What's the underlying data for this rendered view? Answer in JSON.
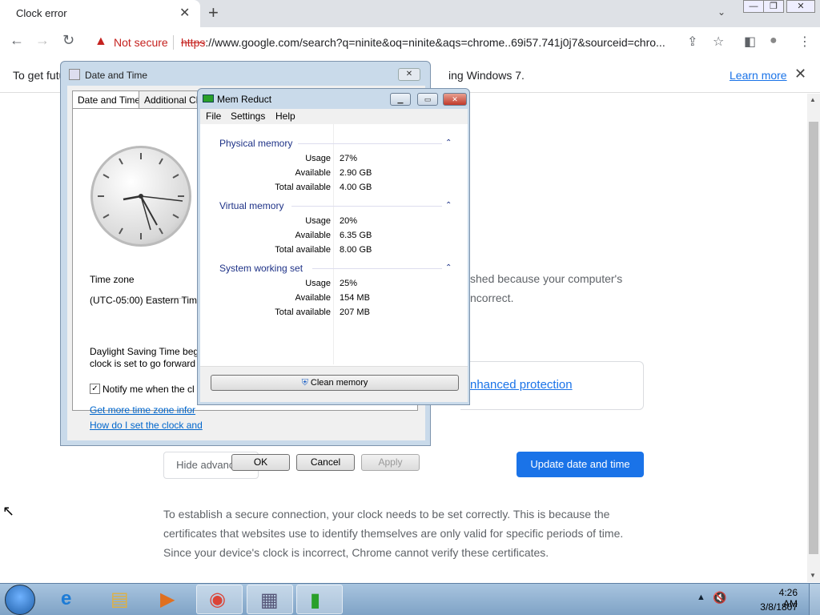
{
  "browser": {
    "tab_title": "Clock error",
    "tab_close": "✕",
    "new_tab": "+",
    "tab_search": "⌄",
    "security_label": "Not secure",
    "url_scheme": "https",
    "url_rest": "://www.google.com/search?q=ninite&oq=ninite&aqs=chrome..69i57.741j0j7&sourceid=chro...",
    "nav_back": "←",
    "nav_forward": "→",
    "nav_reload": "↻",
    "share_icon": "⇪",
    "star_icon": "☆",
    "sidepanel_icon": "◧",
    "profile_icon": "●",
    "menu_icon": "⋮"
  },
  "infobar": {
    "text_left": "To get futu",
    "text_right": "ing Windows 7.",
    "learn_more": "Learn more",
    "close": "✕"
  },
  "page": {
    "error_line1": "shed because your computer's",
    "error_line2": "ncorrect.",
    "enhanced_link": "nhanced protection",
    "hide_advanced": "Hide advanced",
    "update_button": "Update date and time",
    "explanation": "To establish a secure connection, your clock needs to be set correctly. This is because the certificates that websites use to identify themselves are only valid for specific periods of time. Since your device's clock is incorrect, Chrome cannot verify these certificates."
  },
  "date_time_dialog": {
    "title": "Date and Time",
    "close": "✕",
    "tabs": [
      "Date and Time",
      "Additional Cloc"
    ],
    "time_zone_label": "Time zone",
    "time_zone_value": "(UTC-05:00) Eastern Time",
    "dst_line1": "Daylight Saving Time beg",
    "dst_line2": "clock is set to go forward",
    "notify_label": "Notify me when the cl",
    "notify_checked": "✓",
    "link1": "Get more time zone infor",
    "link2": "How do I set the clock and",
    "ok": "OK",
    "cancel": "Cancel",
    "apply": "Apply"
  },
  "mem_reduct": {
    "title": "Mem Reduct",
    "minimize": "▁",
    "restore": "▭",
    "close": "✕",
    "menu": [
      "File",
      "Settings",
      "Help"
    ],
    "groups": [
      {
        "name": "Physical memory",
        "rows": [
          {
            "label": "Usage",
            "value": "27%"
          },
          {
            "label": "Available",
            "value": "2.90 GB"
          },
          {
            "label": "Total available",
            "value": "4.00 GB"
          }
        ]
      },
      {
        "name": "Virtual memory",
        "rows": [
          {
            "label": "Usage",
            "value": "20%"
          },
          {
            "label": "Available",
            "value": "6.35 GB"
          },
          {
            "label": "Total available",
            "value": "8.00 GB"
          }
        ]
      },
      {
        "name": "System working set",
        "rows": [
          {
            "label": "Usage",
            "value": "25%"
          },
          {
            "label": "Available",
            "value": "154 MB"
          },
          {
            "label": "Total available",
            "value": "207 MB"
          }
        ]
      }
    ],
    "collapse_icon": "⌃",
    "clean_button": "Clean memory"
  },
  "taskbar": {
    "time": "4:26 AM",
    "date": "3/8/1807",
    "tray_chevron": "▲",
    "volume_icon": "🔇"
  }
}
